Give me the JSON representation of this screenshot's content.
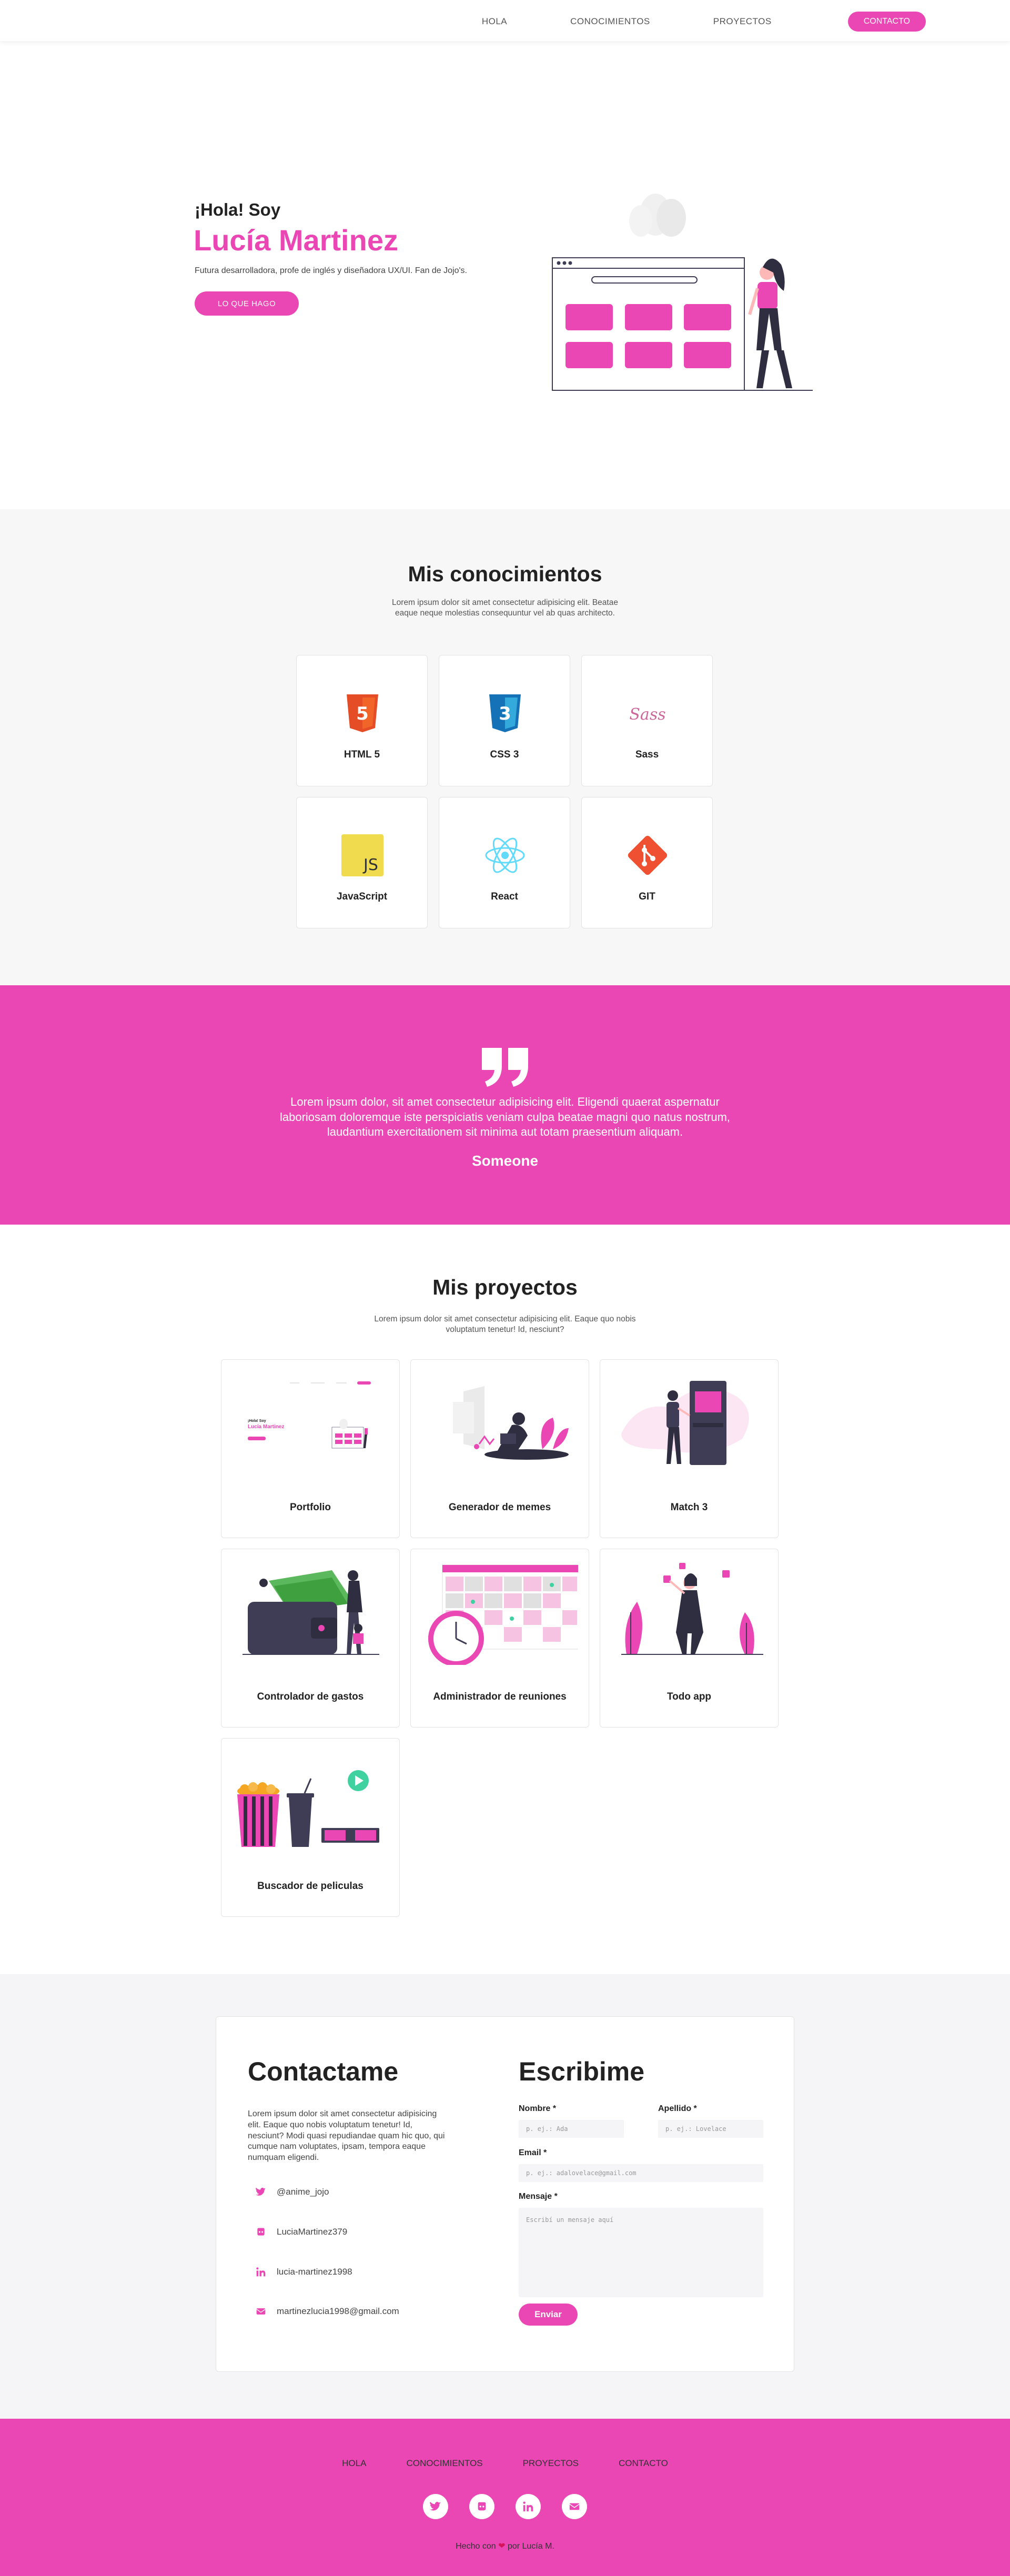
{
  "nav": {
    "links": [
      "HOLA",
      "CONOCIMIENTOS",
      "PROYECTOS"
    ],
    "cta": "CONTACTO"
  },
  "hero": {
    "greeting": "¡Hola! Soy",
    "name": "Lucía Martinez",
    "subtitle": "Futura desarrolladora, profe de inglés y diseñadora UX/UI. Fan de Jojo's.",
    "button": "LO QUE HAGO"
  },
  "skills": {
    "title": "Mis conocimientos",
    "description": "Lorem ipsum dolor sit amet consectetur adipisicing elit. Beatae eaque neque molestias consequuntur vel ab quas architecto.",
    "items": [
      {
        "label": "HTML 5",
        "icon": "html5-icon",
        "color": "#e44d26"
      },
      {
        "label": "CSS 3",
        "icon": "css3-icon",
        "color": "#1572b6"
      },
      {
        "label": "Sass",
        "icon": "sass-icon",
        "color": "#cd6799"
      },
      {
        "label": "JavaScript",
        "icon": "javascript-icon",
        "color": "#f0db4f"
      },
      {
        "label": "React",
        "icon": "react-icon",
        "color": "#61dafb"
      },
      {
        "label": "GIT",
        "icon": "git-icon",
        "color": "#f05032"
      }
    ]
  },
  "quote": {
    "text": "Lorem ipsum dolor, sit amet consectetur adipisicing elit. Eligendi quaerat aspernatur laboriosam doloremque iste perspiciatis veniam culpa beatae magni quo natus nostrum, laudantium exercitationem sit minima aut totam praesentium aliquam.",
    "author": "Someone"
  },
  "projects": {
    "title": "Mis proyectos",
    "description": "Lorem ipsum dolor sit amet consectetur adipisicing elit. Eaque quo nobis voluptatum tenetur! Id, nesciunt?",
    "items": [
      {
        "label": "Portfolio"
      },
      {
        "label": "Generador de memes"
      },
      {
        "label": "Match 3"
      },
      {
        "label": "Controlador de gastos"
      },
      {
        "label": "Administrador de reuniones"
      },
      {
        "label": "Todo app"
      },
      {
        "label": "Buscador de peliculas"
      }
    ],
    "portfolio_thumb": {
      "greeting": "¡Hola! Soy",
      "name": "Lucía Martinez"
    }
  },
  "contact": {
    "title": "Contactame",
    "description": "Lorem ipsum dolor sit amet consectetur adipisicing elit. Eaque quo nobis voluptatum tenetur! Id, nesciunt? Modi quasi repudiandae quam hic quo, qui cumque nam voluptates, ipsam, tempora eaque numquam eligendi.",
    "items": [
      {
        "text": "@anime_jojo",
        "icon": "twitter-icon"
      },
      {
        "text": "LuciaMartinez379",
        "icon": "github-icon"
      },
      {
        "text": "lucia-martinez1998",
        "icon": "linkedin-icon"
      },
      {
        "text": "martinezlucia1998@gmail.com",
        "icon": "envelope-icon"
      }
    ],
    "form": {
      "title": "Escribime",
      "nombre_label": "Nombre *",
      "nombre_placeholder": "p. ej.: Ada",
      "apellido_label": "Apellido *",
      "apellido_placeholder": "p. ej.: Lovelace",
      "email_label": "Email *",
      "email_placeholder": "p. ej.: adalovelace@gmail.com",
      "mensaje_label": "Mensaje *",
      "mensaje_placeholder": "Escribí un mensaje aquí",
      "submit": "Enviar"
    }
  },
  "footer": {
    "links": [
      "HOLA",
      "CONOCIMIENTOS",
      "PROYECTOS",
      "CONTACTO"
    ],
    "made_prefix": "Hecho con",
    "made_suffix": "por Lucía M."
  },
  "colors": {
    "accent": "#ea47b5",
    "dark": "#2f2e41"
  }
}
